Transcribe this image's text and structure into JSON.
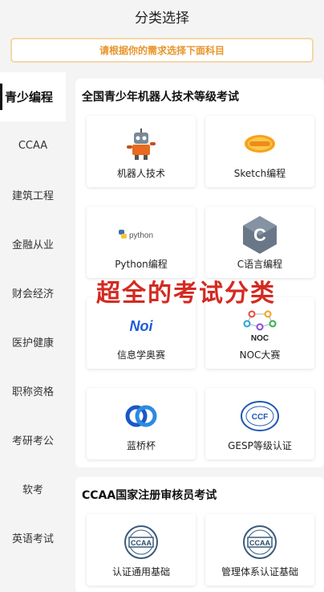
{
  "header": {
    "title": "分类选择"
  },
  "notice": {
    "text": "请根据你的需求选择下面科目"
  },
  "sidebar": {
    "items": [
      {
        "label": "青少编程",
        "active": true
      },
      {
        "label": "CCAA"
      },
      {
        "label": "建筑工程"
      },
      {
        "label": "金融从业"
      },
      {
        "label": "财会经济"
      },
      {
        "label": "医护健康"
      },
      {
        "label": "职称资格"
      },
      {
        "label": "考研考公"
      },
      {
        "label": "软考"
      },
      {
        "label": "英语考试"
      }
    ]
  },
  "sections": [
    {
      "title": "全国青少年机器人技术等级考试",
      "cards": [
        {
          "label": "机器人技术",
          "icon": "robot-icon"
        },
        {
          "label": "Sketch编程",
          "icon": "scratch-icon"
        },
        {
          "label": "Python编程",
          "icon": "python-icon",
          "icon_text": "python"
        },
        {
          "label": "C语言编程",
          "icon": "c-language-icon",
          "icon_text": "C"
        },
        {
          "label": "信息学奥赛",
          "icon": "noi-icon",
          "icon_text": "Noi"
        },
        {
          "label": "NOC大赛",
          "icon": "noc-icon",
          "icon_text": "NOC"
        },
        {
          "label": "蓝桥杯",
          "icon": "lanqiao-icon"
        },
        {
          "label": "GESP等级认证",
          "icon": "gesp-icon",
          "icon_text": "CCF"
        }
      ]
    },
    {
      "title": "CCAA国家注册审核员考试",
      "cards": [
        {
          "label": "认证通用基础",
          "icon": "ccaa-icon",
          "icon_text": "CCAA"
        },
        {
          "label": "管理体系认证基础",
          "icon": "ccaa-icon",
          "icon_text": "CCAA"
        }
      ]
    }
  ],
  "overlay": {
    "text": "超全的考试分类"
  },
  "colors": {
    "accent_orange": "#e8952a",
    "overlay_red": "#d42a22",
    "noi_blue": "#1f5bd8",
    "c_gray": "#6a7788"
  }
}
